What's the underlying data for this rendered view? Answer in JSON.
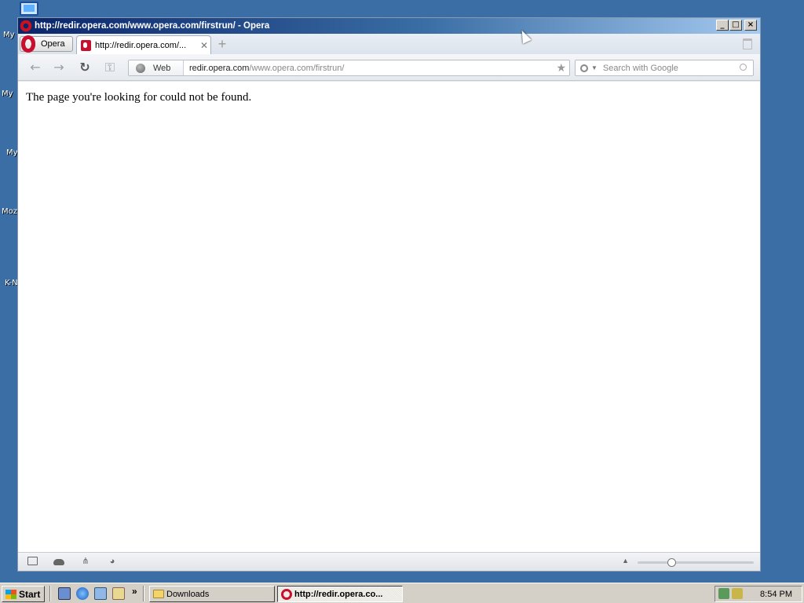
{
  "desktop": {
    "icons": [
      {
        "label": "My"
      },
      {
        "label": "My I"
      },
      {
        "label": "My"
      },
      {
        "label": "Moz"
      },
      {
        "label": "K-N"
      }
    ]
  },
  "window": {
    "title": "http://redir.opera.com/www.opera.com/firstrun/ - Opera",
    "controls": {
      "minimize": "_",
      "maximize": "□",
      "close": "×"
    }
  },
  "tabbar": {
    "menu_label": "Opera",
    "tabs": [
      {
        "title": "http://redir.opera.com/...",
        "active": true
      }
    ],
    "new_tab": "+"
  },
  "navbar": {
    "back": "←",
    "forward": "→",
    "reload": "↻",
    "address": {
      "site_label": "Web",
      "url_host": "redir.opera.com",
      "url_path": "/www.opera.com/firstrun/"
    },
    "search": {
      "placeholder": "Search with Google"
    }
  },
  "content": {
    "message": "The page you're looking for could not be found."
  },
  "statusbar": {
    "zoom_level": 0.28
  },
  "taskbar": {
    "start_label": "Start",
    "chevron": "»",
    "tasks": [
      {
        "label": "Downloads",
        "icon": "folder-icon",
        "active": false
      },
      {
        "label": "http://redir.opera.co...",
        "icon": "opera-icon",
        "active": true
      }
    ],
    "clock": "8:54 PM"
  }
}
